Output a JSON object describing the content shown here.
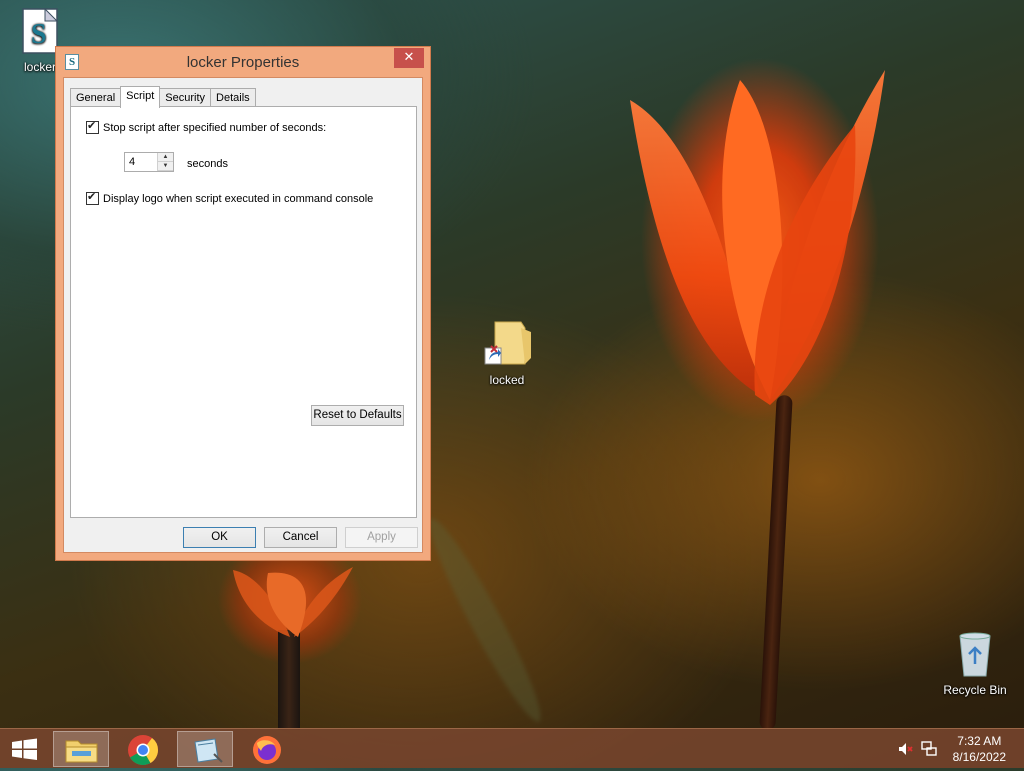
{
  "window": {
    "title": "locker Properties",
    "close_icon": "close-icon",
    "tabs": [
      {
        "label": "General",
        "active": false
      },
      {
        "label": "Script",
        "active": true
      },
      {
        "label": "Security",
        "active": false
      },
      {
        "label": "Details",
        "active": false
      }
    ],
    "script_tab": {
      "stop_script_label": "Stop script after specified number of seconds:",
      "stop_script_checked": true,
      "seconds_value": "4",
      "seconds_label": "seconds",
      "display_logo_label": "Display logo when script executed in command console",
      "display_logo_checked": true,
      "reset_button": "Reset to Defaults"
    },
    "buttons": {
      "ok": "OK",
      "cancel": "Cancel",
      "apply": "Apply"
    }
  },
  "desktop": {
    "icons": [
      {
        "label": "locker",
        "icon": "script-file-icon"
      },
      {
        "label": "locked",
        "icon": "folder-shortcut-icon"
      },
      {
        "label": "Recycle Bin",
        "icon": "recycle-bin-icon"
      }
    ]
  },
  "taskbar": {
    "items": [
      {
        "name": "start-button",
        "icon": "windows-logo-icon"
      },
      {
        "name": "file-explorer",
        "icon": "file-explorer-icon"
      },
      {
        "name": "chrome",
        "icon": "chrome-icon"
      },
      {
        "name": "script-host",
        "icon": "script-window-icon"
      },
      {
        "name": "firefox",
        "icon": "firefox-icon"
      }
    ],
    "tray": {
      "volume_icon": "volume-muted-icon",
      "network_icon": "network-icon",
      "time": "7:32 AM",
      "date": "8/16/2022"
    }
  }
}
